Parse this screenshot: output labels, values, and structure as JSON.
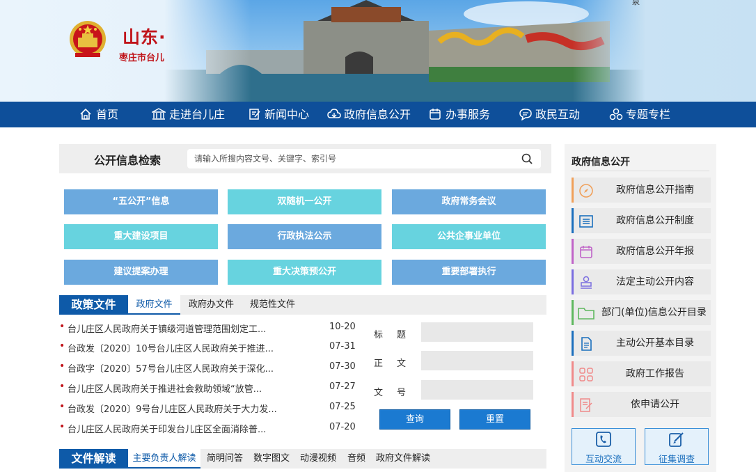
{
  "header": {
    "title": "山东·台儿庄",
    "subtitle": "枣庄市台儿庄区人民政府",
    "corner_text": "泉"
  },
  "nav": {
    "items": [
      {
        "label": "首页",
        "icon": "home-icon"
      },
      {
        "label": "走进台儿庄",
        "icon": "building-icon"
      },
      {
        "label": "新闻中心",
        "icon": "edit-icon"
      },
      {
        "label": "政府信息公开",
        "icon": "cloud-icon"
      },
      {
        "label": "办事服务",
        "icon": "service-icon"
      },
      {
        "label": "政民互动",
        "icon": "chat-icon"
      },
      {
        "label": "专题专栏",
        "icon": "topics-icon"
      }
    ]
  },
  "search": {
    "label": "公开信息检索",
    "placeholder": "请输入所搜内容文号、关键字、索引号"
  },
  "categories": [
    {
      "label": "“五公开”信息",
      "color": "#6ba9de"
    },
    {
      "label": "双随机一公开",
      "color": "#67d3df"
    },
    {
      "label": "政府常务会议",
      "color": "#6ba9de"
    },
    {
      "label": "重大建设项目",
      "color": "#67d3df"
    },
    {
      "label": "行政执法公示",
      "color": "#6ba9de"
    },
    {
      "label": "公共企事业单位",
      "color": "#67d3df"
    },
    {
      "label": "建议提案办理",
      "color": "#6ba9de"
    },
    {
      "label": "重大决策预公开",
      "color": "#67d3df"
    },
    {
      "label": "重要部署执行",
      "color": "#6ba9de"
    }
  ],
  "policy": {
    "title": "政策文件",
    "tabs": [
      "政府文件",
      "政府办文件",
      "规范性文件"
    ],
    "active_tab": "政府文件",
    "docs": [
      {
        "title": "台儿庄区人民政府关于镇级河道管理范围划定工...",
        "date": "10-20"
      },
      {
        "title": "台政发〔2020〕10号台儿庄区人民政府关于推进...",
        "date": "07-31"
      },
      {
        "title": "台政字〔2020〕57号台儿庄区人民政府关于深化...",
        "date": "07-30"
      },
      {
        "title": "台儿庄区人民政府关于推进社会救助领域“放管...",
        "date": "07-27"
      },
      {
        "title": "台政发〔2020〕9号台儿庄区人民政府关于大力发...",
        "date": "07-25"
      },
      {
        "title": "台儿庄区人民政府关于印发台儿庄区全面消除普...",
        "date": "07-20"
      }
    ],
    "form": {
      "fields": [
        {
          "label": "标题",
          "value": ""
        },
        {
          "label": "正文",
          "value": ""
        },
        {
          "label": "文号",
          "value": ""
        }
      ],
      "query_label": "查询",
      "reset_label": "重置"
    }
  },
  "interpretation": {
    "title": "文件解读",
    "tabs": [
      "主要负责人解读",
      "简明问答",
      "数字图文",
      "动漫视频",
      "音频",
      "政府文件解读"
    ],
    "active_tab": "主要负责人解读"
  },
  "sidebar": {
    "title": "政府信息公开",
    "items": [
      {
        "label": "政府信息公开指南",
        "icon": "compass-icon",
        "color": "#f0a05a"
      },
      {
        "label": "政府信息公开制度",
        "icon": "list-icon",
        "color": "#1b6fbd"
      },
      {
        "label": "政府信息公开年报",
        "icon": "calendar-icon",
        "color": "#c064c8"
      },
      {
        "label": "法定主动公开内容",
        "icon": "stamp-icon",
        "color": "#7b6ee0"
      },
      {
        "label": "部门(单位)信息公开目录",
        "icon": "folder-icon",
        "color": "#5fb85f"
      },
      {
        "label": "主动公开基本目录",
        "icon": "document-icon",
        "color": "#1b6fbd"
      },
      {
        "label": "政府工作报告",
        "icon": "grid-icon",
        "color": "#f08a8a"
      },
      {
        "label": "依申请公开",
        "icon": "form-icon",
        "color": "#f08a8a"
      }
    ],
    "buttons": [
      {
        "label": "互动交流",
        "icon": "phone-icon"
      },
      {
        "label": "征集调查",
        "icon": "survey-icon"
      }
    ]
  }
}
